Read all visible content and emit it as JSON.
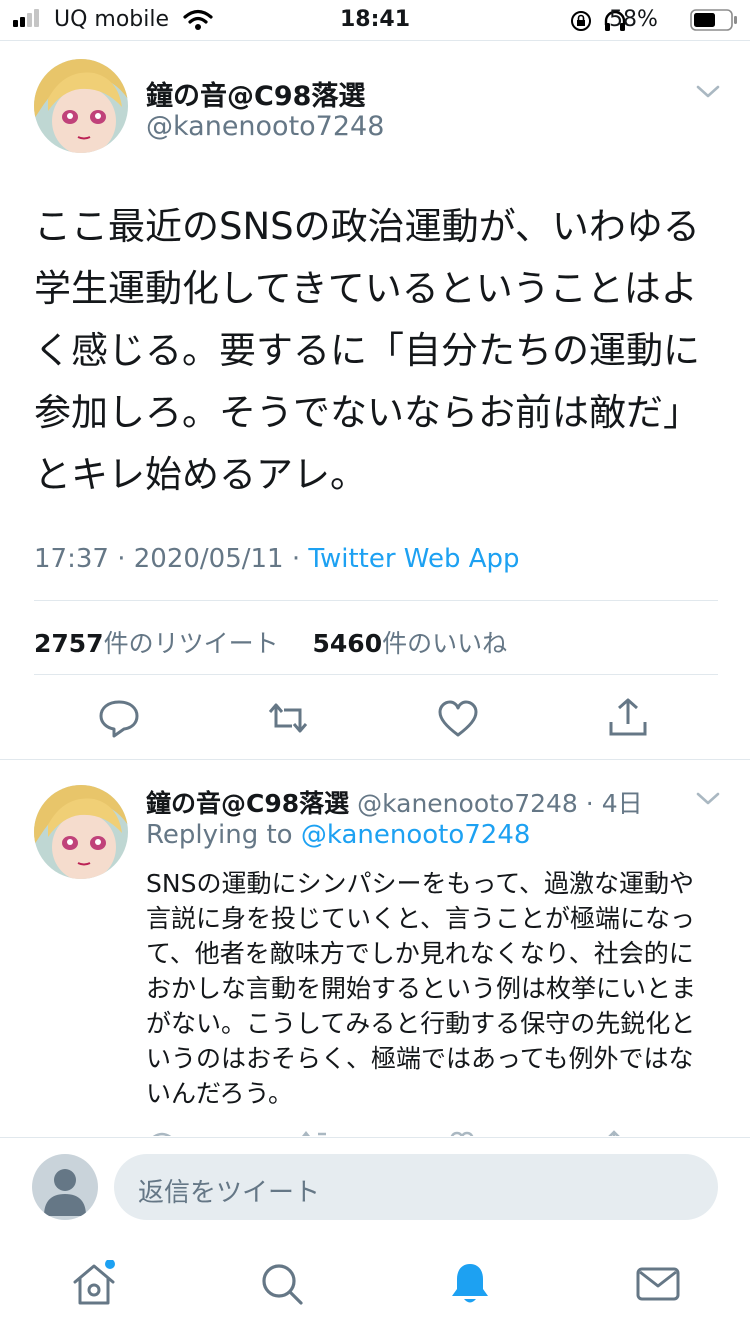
{
  "status_bar": {
    "carrier": "UQ mobile",
    "time": "18:41",
    "battery": "58%"
  },
  "tweet": {
    "display_name": "鐘の音@C98落選",
    "handle": "@kanenooto7248",
    "text": "ここ最近のSNSの政治運動が、いわゆる学生運動化してきているということはよく感じる。要するに「自分たちの運動に参加しろ。そうでないならお前は敵だ」とキレ始めるアレ。",
    "time": "17:37",
    "date": "2020/05/11",
    "source": "Twitter Web App",
    "retweet_count": "2757",
    "retweet_label": "件のリツイート",
    "like_count": "5460",
    "like_label": "件のいいね"
  },
  "reply": {
    "display_name": "鐘の音@C98落選",
    "handle": "@kanenooto7248",
    "age": "4日",
    "replying_prefix": "Replying to",
    "replying_to": "@kanenooto7248",
    "text": "SNSの運動にシンパシーをもって、過激な運動や言説に身を投じていくと、言うことが極端になって、他者を敵味方でしか見れなくなり、社会的におかしな言動を開始するという例は枚挙にいとまがない。こうしてみると行動する保守の先鋭化というのはおそらく、極端ではあっても例外ではないんだろう。"
  },
  "composer": {
    "placeholder": "返信をツイート"
  },
  "colors": {
    "accent": "#1da1f2",
    "secondary_text": "#657786",
    "divider": "#e1e8ed"
  },
  "icons": [
    "signal-icon",
    "wifi-icon",
    "rotation-lock-icon",
    "headphones-icon",
    "battery-icon",
    "chevron-down-icon",
    "reply-icon",
    "retweet-icon",
    "like-icon",
    "share-icon",
    "home-icon",
    "search-icon",
    "notifications-icon",
    "messages-icon"
  ]
}
